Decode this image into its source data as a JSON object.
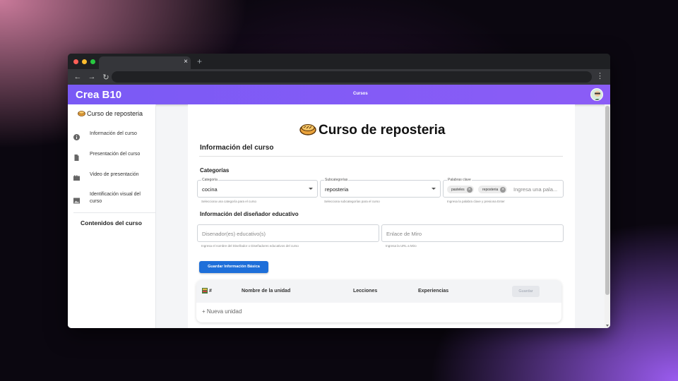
{
  "browser": {
    "tab_close": "×",
    "new_tab": "+",
    "nav": {
      "back": "←",
      "forward": "→",
      "reload": "↻"
    },
    "menu": "⋮"
  },
  "appbar": {
    "brand": "Crea B10",
    "link": "Cursos"
  },
  "sidebar": {
    "title": "Curso de reposteria",
    "items": [
      {
        "label": "Información del curso",
        "icon": "info-icon"
      },
      {
        "label": "Presentación del curso",
        "icon": "document-icon"
      },
      {
        "label": "Video de presentación",
        "icon": "movie-icon"
      },
      {
        "label": "Identificación visual del curso",
        "icon": "image-icon"
      }
    ],
    "section": "Contenidos del curso"
  },
  "main": {
    "title": "Curso de reposteria",
    "section_title": "Información del curso",
    "categories_title": "Categorías",
    "fields": {
      "categoria": {
        "label": "Categoría",
        "value": "cocina",
        "helper": "Selecciona una categoría para el curso"
      },
      "subcategorias": {
        "label": "Subcategorías",
        "value": "reposteria",
        "helper": "Selecciona subcategorías para el curso"
      },
      "palabras": {
        "label": "Palabras clave",
        "placeholder": "Ingresa una pala...",
        "chips": [
          "pasteles",
          "reposteria"
        ],
        "helper": "Ingresa la palabra clave y presiona Enter"
      }
    },
    "designer_title": "Información del diseñador educativo",
    "designer_fields": {
      "disenador": {
        "placeholder": "Disenador(es) educativo(s)",
        "helper": "Ingresa el nombre del Diseñador o Diseñadores educativos del curso"
      },
      "miro": {
        "placeholder": "Enlace de Miro",
        "helper": "Ingresa la URL a Miro"
      }
    },
    "save_button": "Guardar Información Básica",
    "table": {
      "columns": [
        "#",
        "Nombre de la unidad",
        "Lecciones",
        "Experiencias"
      ],
      "save_button": "Guardar",
      "new_unit": "+ Nueva unidad"
    }
  },
  "colors": {
    "appbar": "#7a5af5",
    "primary_button": "#1e6fd9"
  }
}
